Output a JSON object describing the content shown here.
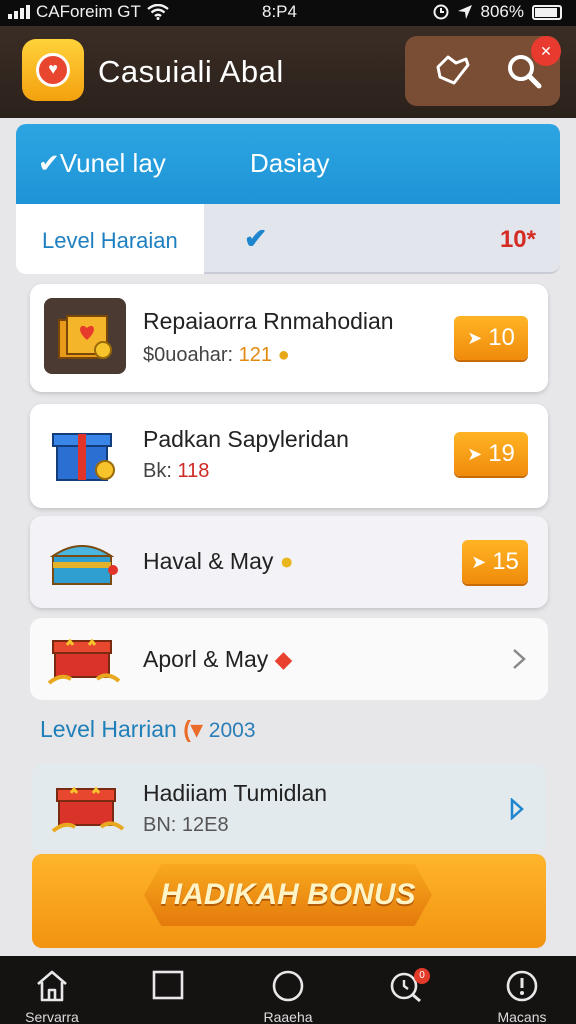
{
  "status": {
    "carrier": "CAForeim GT",
    "time": "8:P4",
    "battery": "806%"
  },
  "header": {
    "title": "Casuiali Abal"
  },
  "tabs": {
    "left": "Vunel lay",
    "right": "Dasiay"
  },
  "subtabs": {
    "label": "Level Haraian",
    "count": "10*"
  },
  "items": [
    {
      "title": "Repaiaorra Rnmahodian",
      "sub_label": "$0uoahar:",
      "sub_value": "121",
      "reward": "10"
    },
    {
      "title": "Padkan Sapyleridan",
      "sub_label": "Bk:",
      "sub_value": "118",
      "reward": "19"
    },
    {
      "title": "Haval & May",
      "reward": "15"
    },
    {
      "title": "Aporl & May"
    }
  ],
  "section": {
    "title": "Level Harrian",
    "year": "2003"
  },
  "featured": {
    "title": "Hadiiam Tumidlan",
    "sub": "BN: 12E8"
  },
  "bonus": {
    "label": "HADIKAH BONUS"
  },
  "nav": {
    "home": "Servarra",
    "middle": "Raaeha",
    "right": "Macans",
    "badge": "0"
  },
  "colors": {
    "header_bg": "#2b211b",
    "tab_blue": "#1e94d6",
    "reward_orange": "#f08b0c",
    "bonus_orange": "#f29311"
  }
}
